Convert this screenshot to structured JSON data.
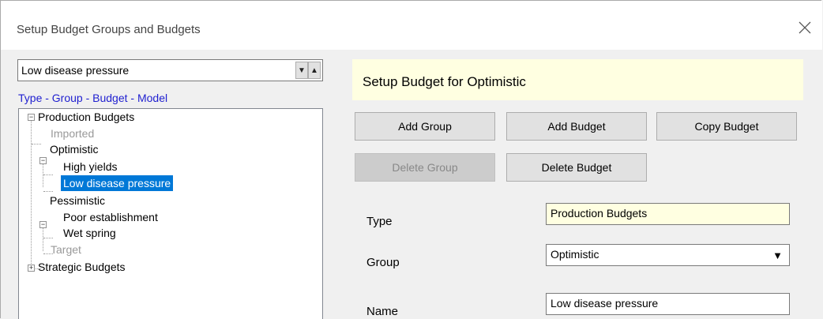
{
  "window": {
    "title": "Setup Budget Groups and Budgets"
  },
  "selector": {
    "value": "Low disease pressure",
    "down_icon": "triangle-down",
    "up_icon": "triangle-up"
  },
  "hierarchy_link": "Type - Group - Budget - Model",
  "tree": {
    "production": "Production Budgets",
    "imported": "Imported",
    "optimistic": "Optimistic",
    "high_yields": "High yields",
    "low_disease": "Low disease pressure",
    "pessimistic": "Pessimistic",
    "poor_establishment": "Poor establishment",
    "wet_spring": "Wet spring",
    "target": "Target",
    "strategic": "Strategic Budgets"
  },
  "header": {
    "text": "Setup Budget for Optimistic"
  },
  "buttons": {
    "add_group": "Add Group",
    "add_budget": "Add Budget",
    "copy_budget": "Copy Budget",
    "delete_group": "Delete Group",
    "delete_budget": "Delete Budget"
  },
  "form": {
    "type_label": "Type",
    "type_value": "Production Budgets",
    "group_label": "Group",
    "group_value": "Optimistic",
    "name_label": "Name",
    "name_value": "Low disease pressure"
  },
  "colors": {
    "selection": "#0078d7",
    "tooltip_yellow": "#ffffe1",
    "link_blue": "#1f1fd0"
  }
}
